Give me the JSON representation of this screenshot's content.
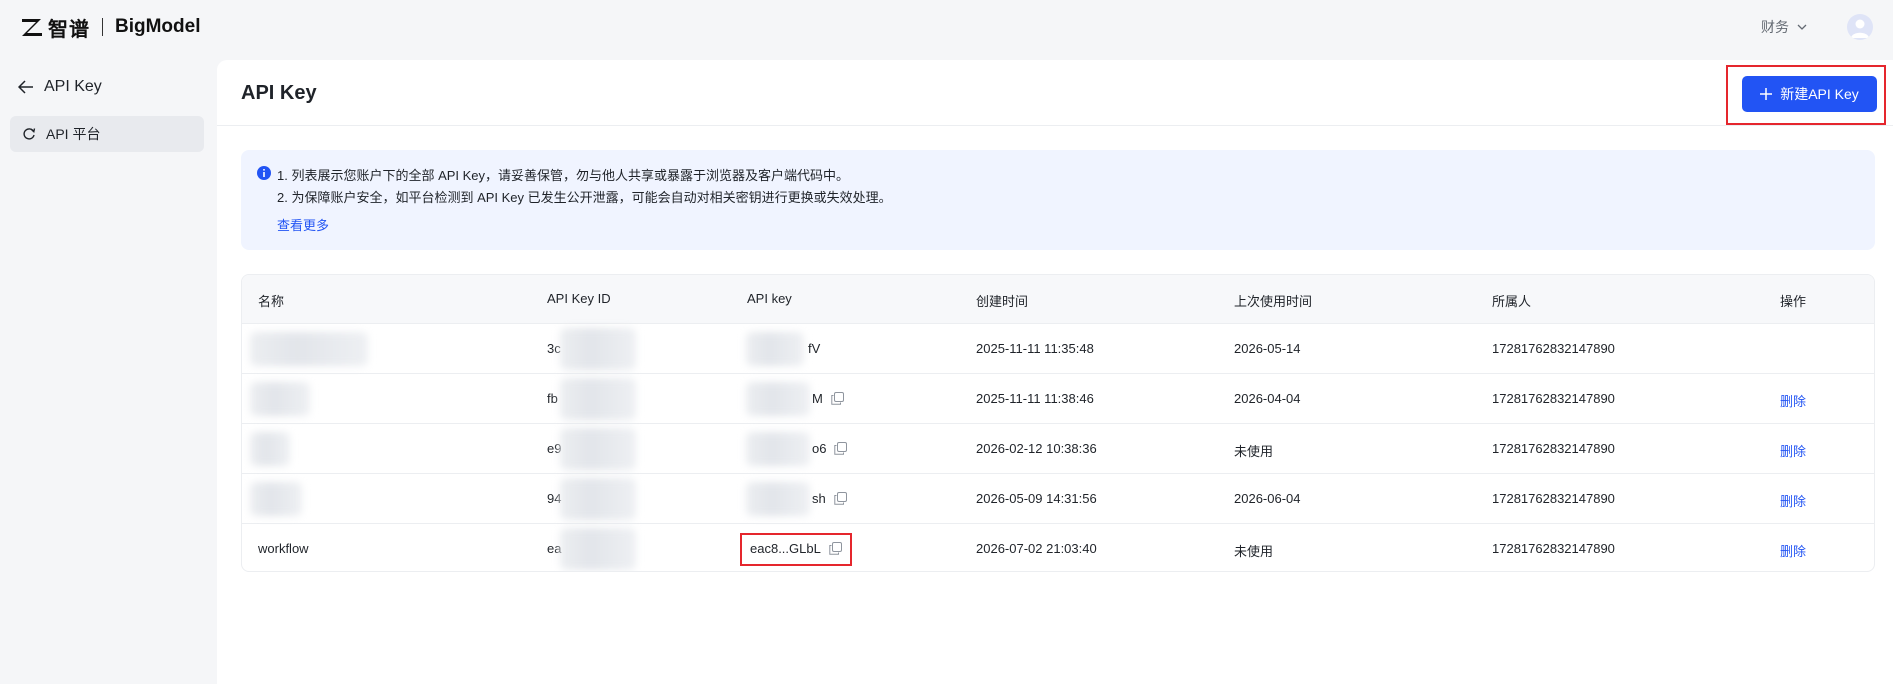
{
  "brand": {
    "cn_name": "智谱",
    "en_name": "BigModel"
  },
  "topbar": {
    "finance_label": "财务"
  },
  "sidebar": {
    "back_label": "API Key",
    "items": [
      {
        "label": "API 平台"
      }
    ]
  },
  "page": {
    "title": "API Key",
    "new_button_label": "新建API Key"
  },
  "notice": {
    "lines": [
      "1. 列表展示您账户下的全部 API Key，请妥善保管，勿与他人共享或暴露于浏览器及客户端代码中。",
      "2. 为保障账户安全，如平台检测到 API Key 已发生公开泄露，可能会自动对相关密钥进行更换或失效处理。"
    ],
    "more_label": "查看更多"
  },
  "table": {
    "headers": [
      "名称",
      "API Key ID",
      "API key",
      "创建时间",
      "上次使用时间",
      "所属人",
      "操作"
    ],
    "rows": [
      {
        "name": "",
        "key_id": "3c",
        "api_key": "fV",
        "created": "2025-11-11 11:35:48",
        "last_used": "2026-05-14",
        "owner": "17281762832147890",
        "action": ""
      },
      {
        "name": "",
        "key_id": "fb",
        "api_key": "M",
        "created": "2025-11-11 11:38:46",
        "last_used": "2026-04-04",
        "owner": "17281762832147890",
        "action": "删除"
      },
      {
        "name": "",
        "key_id": "e9",
        "api_key": "o6",
        "created": "2026-02-12 10:38:36",
        "last_used": "未使用",
        "owner": "17281762832147890",
        "action": "删除"
      },
      {
        "name": "",
        "key_id": "94",
        "api_key": "sh",
        "created": "2026-05-09 14:31:56",
        "last_used": "2026-06-04",
        "owner": "17281762832147890",
        "action": "删除"
      },
      {
        "name": "workflow",
        "key_id": "ea",
        "api_key": "eac8...GLbL",
        "created": "2026-07-02 21:03:40",
        "last_used": "未使用",
        "owner": "17281762832147890",
        "action": "删除"
      }
    ]
  },
  "colors": {
    "primary": "#2254f4",
    "highlight": "#e5262d"
  }
}
